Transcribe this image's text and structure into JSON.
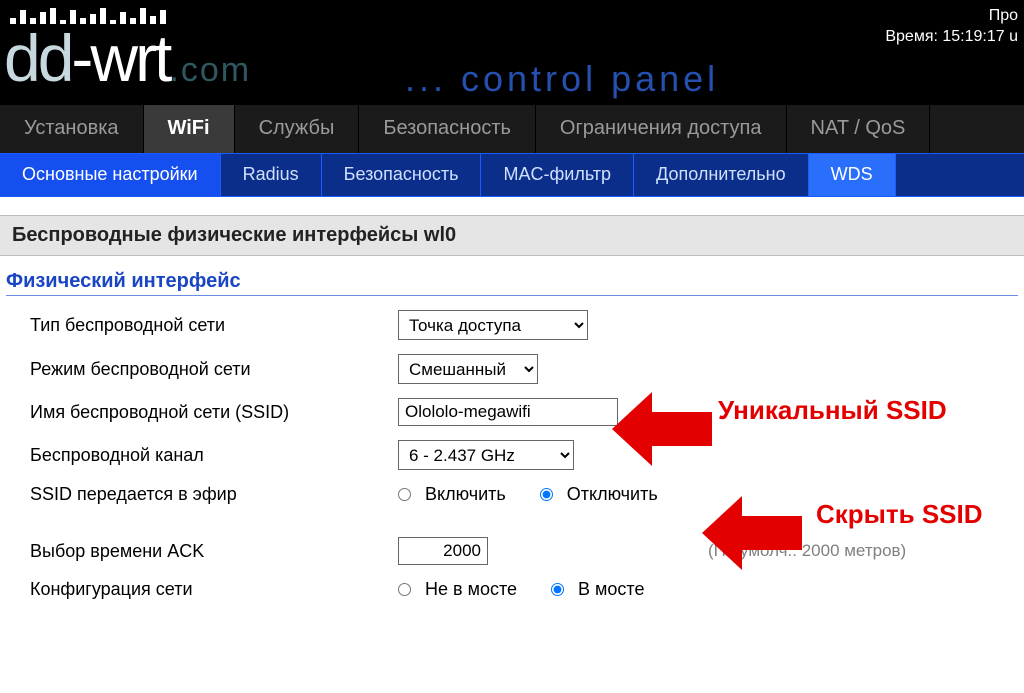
{
  "header": {
    "logo_dd": "dd",
    "logo_wrt": "-wrt",
    "logo_com": ".com",
    "subtitle": "... control panel",
    "top_right_1": "Про",
    "top_right_2": "Время: 15:19:17 u"
  },
  "main_tabs": [
    {
      "label": "Установка",
      "active": false
    },
    {
      "label": "WiFi",
      "active": true
    },
    {
      "label": "Службы",
      "active": false
    },
    {
      "label": "Безопасность",
      "active": false
    },
    {
      "label": "Ограничения доступа",
      "active": false
    },
    {
      "label": "NAT / QoS",
      "active": false
    }
  ],
  "sub_tabs": [
    {
      "label": "Основные настройки",
      "cls": "active"
    },
    {
      "label": "Radius",
      "cls": ""
    },
    {
      "label": "Безопасность",
      "cls": ""
    },
    {
      "label": "MAC-фильтр",
      "cls": ""
    },
    {
      "label": "Дополнительно",
      "cls": ""
    },
    {
      "label": "WDS",
      "cls": "light"
    }
  ],
  "section_title": "Беспроводные физические интерфейсы wl0",
  "subsection": "Физический интерфейс",
  "fields": {
    "type_label": "Тип беспроводной сети",
    "type_value": "Точка доступа",
    "mode_label": "Режим беспроводной сети",
    "mode_value": "Смешанный",
    "ssid_label": "Имя беспроводной сети (SSID)",
    "ssid_value": "Olololo-megawifi",
    "channel_label": "Беспроводной канал",
    "channel_value": "6 - 2.437 GHz",
    "broadcast_label": "SSID передается в эфир",
    "broadcast_on": "Включить",
    "broadcast_off": "Отключить",
    "ack_label": "Выбор времени ACK",
    "ack_value": "2000",
    "ack_note": "(По умолч.: 2000 метров)",
    "netconf_label": "Конфигурация сети",
    "netconf_a": "Не в мосте",
    "netconf_b": "В мосте"
  },
  "annotations": {
    "unique_ssid": "Уникальный SSID",
    "hide_ssid": "Скрыть SSID"
  }
}
